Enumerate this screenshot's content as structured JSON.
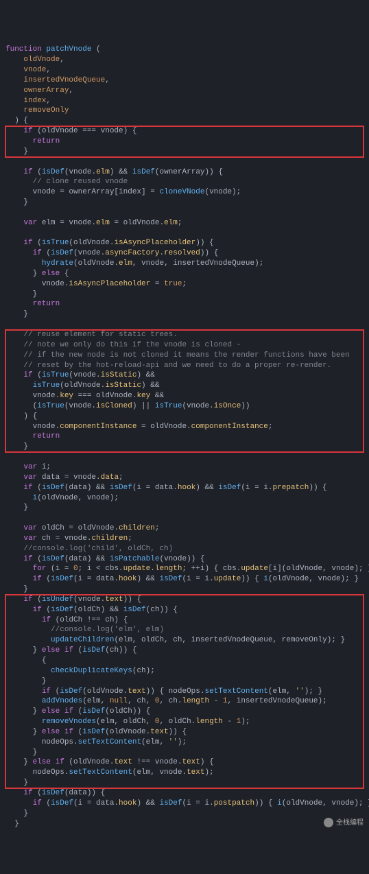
{
  "code": {
    "l1": "function",
    "l1b": "patchVnode",
    "l1c": "(",
    "l2": "oldVnode",
    "l3": "vnode",
    "l4": "insertedVnodeQueue",
    "l5": "ownerArray",
    "l6": "index",
    "l7": "removeOnly",
    "l8": ") {",
    "b1_1": "if",
    "b1_2": "(oldVnode === vnode) {",
    "b1_3": "return",
    "b1_4": "}",
    "s2_1": "if",
    "s2_2": "(",
    "s2_3": "isDef",
    "s2_4": "(vnode.",
    "s2_5": "elm",
    "s2_6": ") && ",
    "s2_7": "isDef",
    "s2_8": "(ownerArray)) {",
    "s2_c": "// clone reused vnode",
    "s2_9": "vnode = ownerArray[index] = ",
    "s2_10": "cloneVNode",
    "s2_11": "(vnode);",
    "s2_12": "}",
    "s3_1": "var",
    "s3_2": " elm = vnode.",
    "s3_3": "elm",
    "s3_4": " = oldVnode.",
    "s3_5": "elm",
    "s3_6": ";",
    "s4_1": "if",
    "s4_2": " (",
    "s4_3": "isTrue",
    "s4_4": "(oldVnode.",
    "s4_5": "isAsyncPlaceholder",
    "s4_6": ")) {",
    "s4_7": "if",
    "s4_8": " (",
    "s4_9": "isDef",
    "s4_10": "(vnode.",
    "s4_11": "asyncFactory",
    "s4_12": ".",
    "s4_13": "resolved",
    "s4_14": ")) {",
    "s4_15": "hydrate",
    "s4_16": "(oldVnode.",
    "s4_17": "elm",
    "s4_18": ", vnode, insertedVnodeQueue);",
    "s4_19": "} ",
    "s4_20": "else",
    "s4_21": " {",
    "s4_22": "vnode.",
    "s4_23": "isAsyncPlaceholder",
    "s4_24": " = ",
    "s4_25": "true",
    "s4_26": ";",
    "s4_27": "}",
    "s4_28": "return",
    "s4_29": "}",
    "b2_c1": "// reuse element for static trees.",
    "b2_c2": "// note we only do this if the vnode is cloned -",
    "b2_c3": "// if the new node is not cloned it means the render functions have been",
    "b2_c4": "// reset by the hot-reload-api and we need to do a proper re-render.",
    "b2_1": "if",
    "b2_2": " (",
    "b2_3": "isTrue",
    "b2_4": "(vnode.",
    "b2_5": "isStatic",
    "b2_6": ") &&",
    "b2_7": "isTrue",
    "b2_8": "(oldVnode.",
    "b2_9": "isStatic",
    "b2_10": ") &&",
    "b2_11": "vnode.",
    "b2_12": "key",
    "b2_13": " === oldVnode.",
    "b2_14": "key",
    "b2_15": " &&",
    "b2_16": "(",
    "b2_17": "isTrue",
    "b2_18": "(vnode.",
    "b2_19": "isCloned",
    "b2_20": ") || ",
    "b2_21": "isTrue",
    "b2_22": "(vnode.",
    "b2_23": "isOnce",
    "b2_24": "))",
    "b2_25": ") {",
    "b2_26": "vnode.",
    "b2_27": "componentInstance",
    "b2_28": " = oldVnode.",
    "b2_29": "componentInstance",
    "b2_30": ";",
    "b2_31": "return",
    "b2_32": "}",
    "s5_1": "var",
    "s5_2": " i;",
    "s5_3": "var",
    "s5_4": " data = vnode.",
    "s5_5": "data",
    "s5_6": ";",
    "s5_7": "if",
    "s5_8": " (",
    "s5_9": "isDef",
    "s5_10": "(data) && ",
    "s5_11": "isDef",
    "s5_12": "(i = data.",
    "s5_13": "hook",
    "s5_14": ") && ",
    "s5_15": "isDef",
    "s5_16": "(i = i.",
    "s5_17": "prepatch",
    "s5_18": ")) {",
    "s5_19": "i",
    "s5_20": "(oldVnode, vnode);",
    "s5_21": "}",
    "s6_1": "var",
    "s6_2": " oldCh = oldVnode.",
    "s6_3": "children",
    "s6_4": ";",
    "s6_5": "var",
    "s6_6": " ch = vnode.",
    "s6_7": "children",
    "s6_8": ";",
    "s6_c": "//console.log('child', oldCh, ch)",
    "s6_9": "if",
    "s6_10": " (",
    "s6_11": "isDef",
    "s6_12": "(data) && ",
    "s6_13": "isPatchable",
    "s6_14": "(vnode)) {",
    "s6_15": "for",
    "s6_16": " (i = ",
    "s6_17": "0",
    "s6_18": "; i < cbs.",
    "s6_19": "update",
    "s6_20": ".",
    "s6_21": "length",
    "s6_22": "; ++i) { cbs.",
    "s6_23": "update",
    "s6_24": "[i](oldVnode, vnode); }",
    "s6_25": "if",
    "s6_26": " (",
    "s6_27": "isDef",
    "s6_28": "(i = data.",
    "s6_29": "hook",
    "s6_30": ") && ",
    "s6_31": "isDef",
    "s6_32": "(i = i.",
    "s6_33": "update",
    "s6_34": ")) { ",
    "s6_35": "i",
    "s6_36": "(oldVnode, vnode); }",
    "s6_37": "}",
    "b3_1": "if",
    "b3_2": " (",
    "b3_3": "isUndef",
    "b3_4": "(vnode.",
    "b3_5": "text",
    "b3_6": ")) {",
    "b3_7": "if",
    "b3_8": " (",
    "b3_9": "isDef",
    "b3_10": "(oldCh) && ",
    "b3_11": "isDef",
    "b3_12": "(ch)) {",
    "b3_13": "if",
    "b3_14": " (oldCh !== ch) {",
    "b3_c": "//console.log('elm', elm)",
    "b3_15": "updateChildren",
    "b3_16": "(elm, oldCh, ch, insertedVnodeQueue, removeOnly); }",
    "b3_17": "} ",
    "b3_18": "else if",
    "b3_19": " (",
    "b3_20": "isDef",
    "b3_21": "(ch)) {",
    "b3_22": "{",
    "b3_23": "checkDuplicateKeys",
    "b3_24": "(ch);",
    "b3_25": "}",
    "b3_26": "if",
    "b3_27": " (",
    "b3_28": "isDef",
    "b3_29": "(oldVnode.",
    "b3_30": "text",
    "b3_31": ")) { nodeOps.",
    "b3_32": "setTextContent",
    "b3_33": "(elm, ",
    "b3_34": "''",
    "b3_35": "); }",
    "b3_36": "addVnodes",
    "b3_37": "(elm, ",
    "b3_38": "null",
    "b3_39": ", ch, ",
    "b3_40": "0",
    "b3_41": ", ch.",
    "b3_42": "length",
    "b3_43": " - ",
    "b3_44": "1",
    "b3_45": ", insertedVnodeQueue);",
    "b3_46": "} ",
    "b3_47": "else if",
    "b3_48": " (",
    "b3_49": "isDef",
    "b3_50": "(oldCh)) {",
    "b3_51": "removeVnodes",
    "b3_52": "(elm, oldCh, ",
    "b3_53": "0",
    "b3_54": ", oldCh.",
    "b3_55": "length",
    "b3_56": " - ",
    "b3_57": "1",
    "b3_58": ");",
    "b3_59": "} ",
    "b3_60": "else if",
    "b3_61": " (",
    "b3_62": "isDef",
    "b3_63": "(oldVnode.",
    "b3_64": "text",
    "b3_65": ")) {",
    "b3_66": "nodeOps.",
    "b3_67": "setTextContent",
    "b3_68": "(elm, ",
    "b3_69": "''",
    "b3_70": ");",
    "b3_71": "}",
    "b3_72": "} ",
    "b3_73": "else if",
    "b3_74": " (oldVnode.",
    "b3_75": "text",
    "b3_76": " !== vnode.",
    "b3_77": "text",
    "b3_78": ") {",
    "b3_79": "nodeOps.",
    "b3_80": "setTextContent",
    "b3_81": "(elm, vnode.",
    "b3_82": "text",
    "b3_83": ");",
    "b3_84": "}",
    "s7_1": "if",
    "s7_2": " (",
    "s7_3": "isDef",
    "s7_4": "(data)) {",
    "s7_5": "if",
    "s7_6": " (",
    "s7_7": "isDef",
    "s7_8": "(i = data.",
    "s7_9": "hook",
    "s7_10": ") && ",
    "s7_11": "isDef",
    "s7_12": "(i = i.",
    "s7_13": "postpatch",
    "s7_14": ")) { ",
    "s7_15": "i",
    "s7_16": "(oldVnode, vnode); }",
    "s7_17": "}",
    "s7_18": "}"
  },
  "watermark": "全栈编程"
}
